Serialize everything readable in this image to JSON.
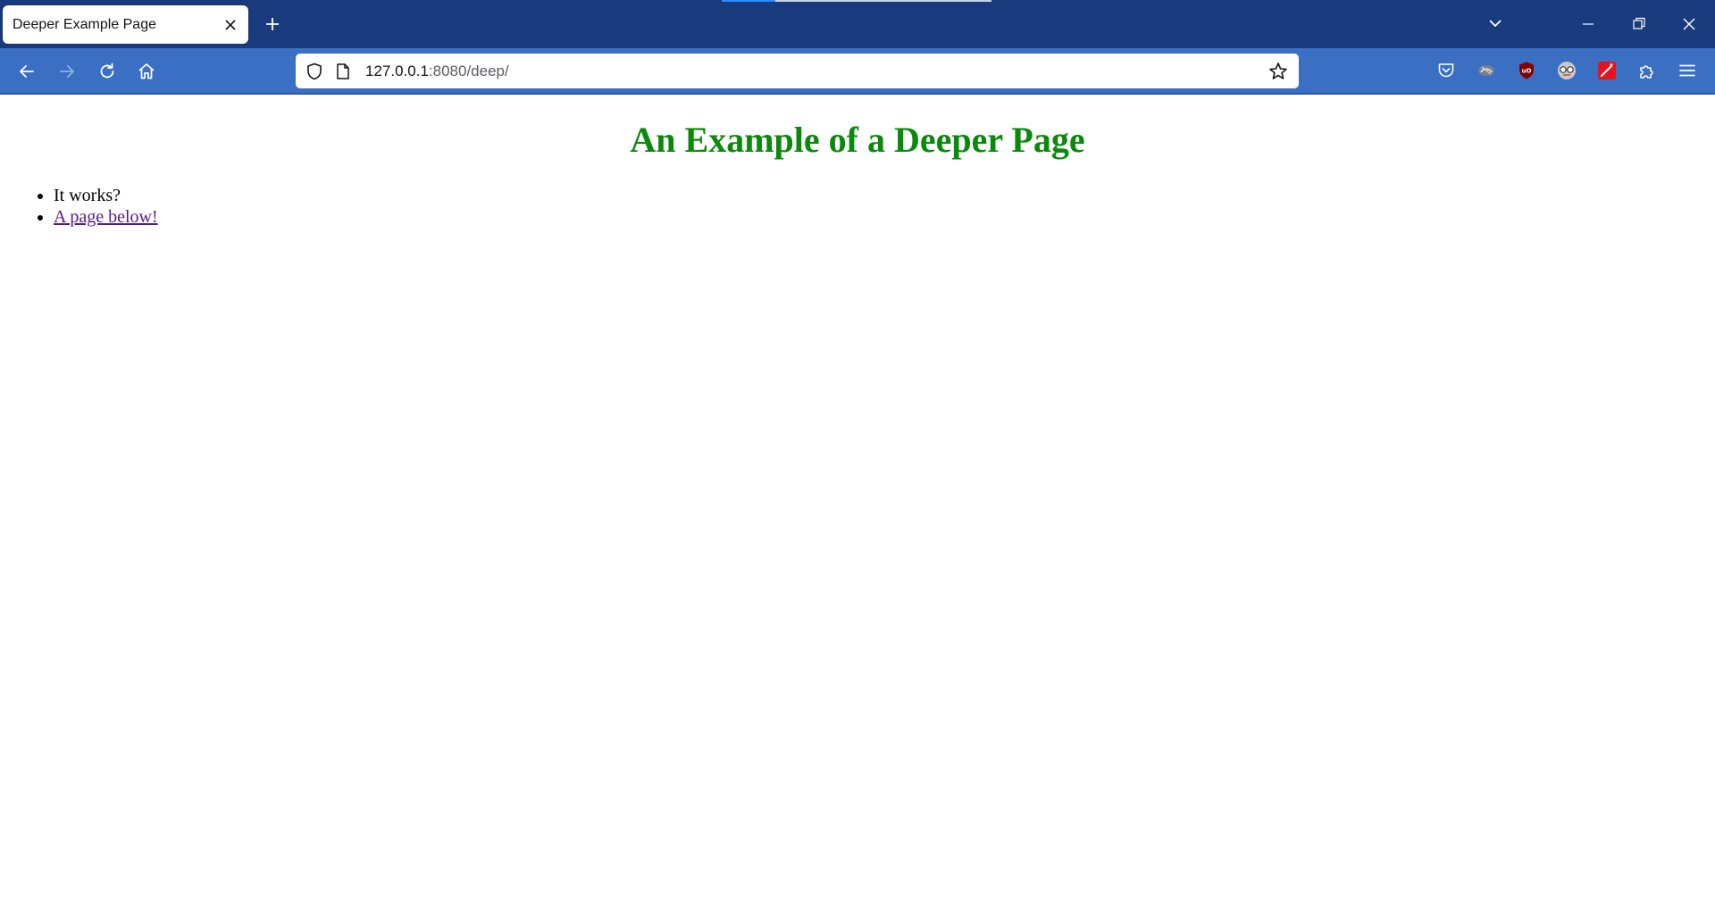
{
  "browser": {
    "tab": {
      "title": "Deeper Example Page"
    },
    "url": {
      "host": "127.0.0.1",
      "rest": ":8080/deep/"
    }
  },
  "page": {
    "heading": "An Example of a Deeper Page",
    "items": [
      {
        "text": "It works?"
      },
      {
        "text": "A page below!",
        "link": true
      }
    ]
  },
  "colors": {
    "heading": "#0a8a0a",
    "link_visited": "#551a8b",
    "tabstrip": "#1a3a7e",
    "navbar": "#3a6fc4"
  },
  "icons": {
    "toolbar": [
      "back-icon",
      "forward-icon",
      "reload-icon",
      "home-icon"
    ],
    "extensions": [
      "pocket-icon",
      "extension-mustache-icon",
      "ublock-icon",
      "extension-glasses-icon",
      "extension-wand-icon",
      "extensions-puzzle-icon",
      "menu-icon"
    ]
  }
}
